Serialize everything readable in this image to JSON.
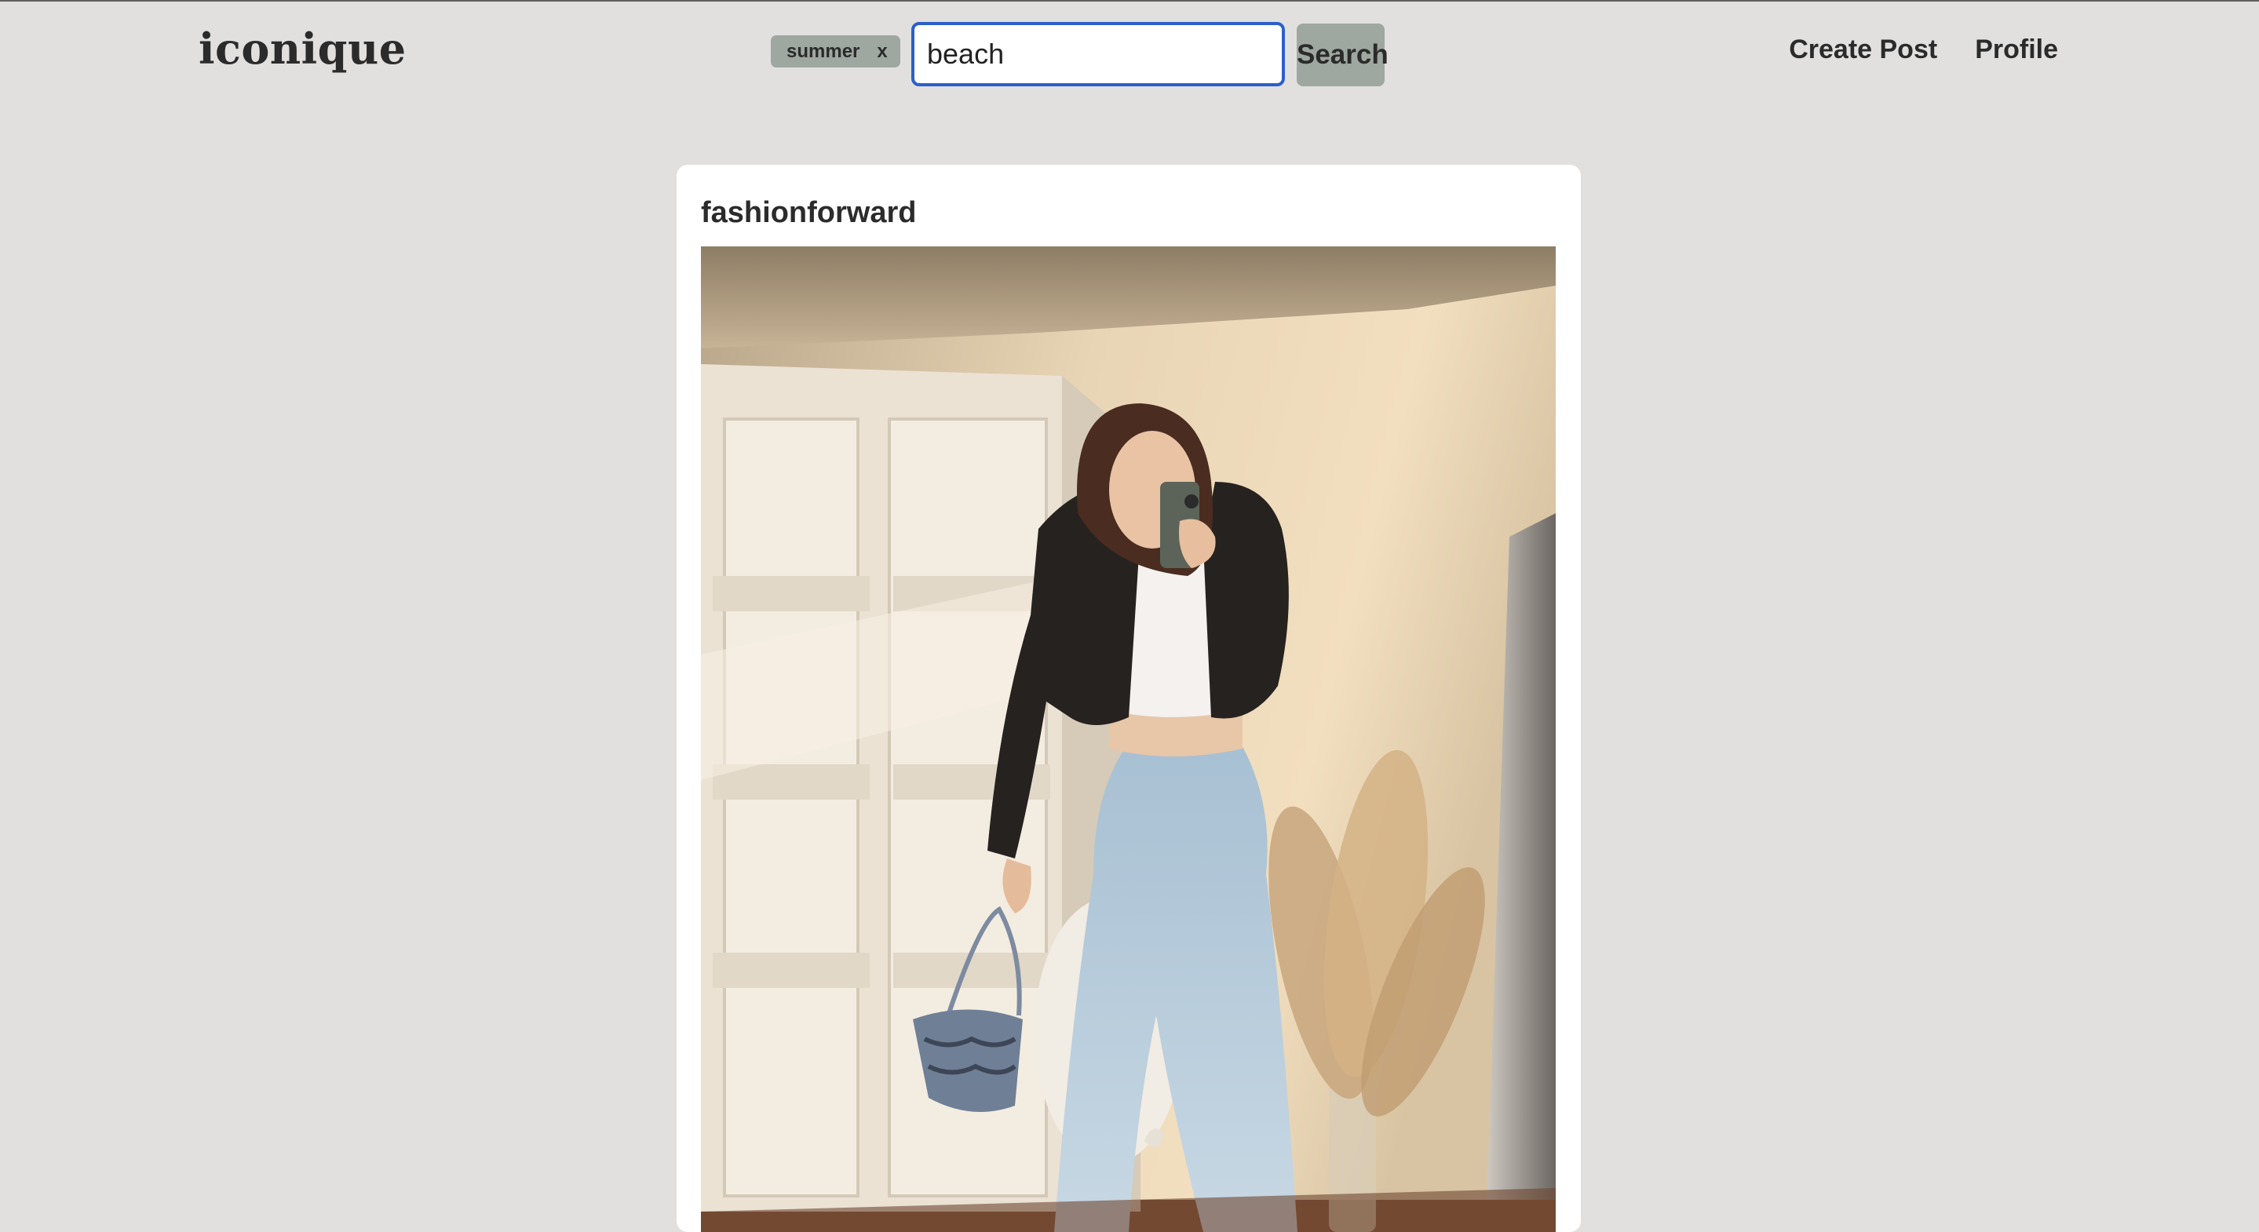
{
  "brand": {
    "logo_text": "iconique"
  },
  "search": {
    "tags": [
      {
        "label": "summer",
        "remove_label": "x"
      }
    ],
    "query": "beach",
    "button_label": "Search"
  },
  "nav": {
    "items": [
      {
        "label": "Create Post"
      },
      {
        "label": "Profile"
      }
    ]
  },
  "post": {
    "username": "fashionforward",
    "image": {
      "icon": "photo"
    }
  },
  "colors": {
    "page_background": "#e1e0df",
    "chip_and_button": "#9ea7a0",
    "input_focus_border": "#2c5fc8",
    "card_background": "#ffffff",
    "text": "#2b2b2b"
  }
}
